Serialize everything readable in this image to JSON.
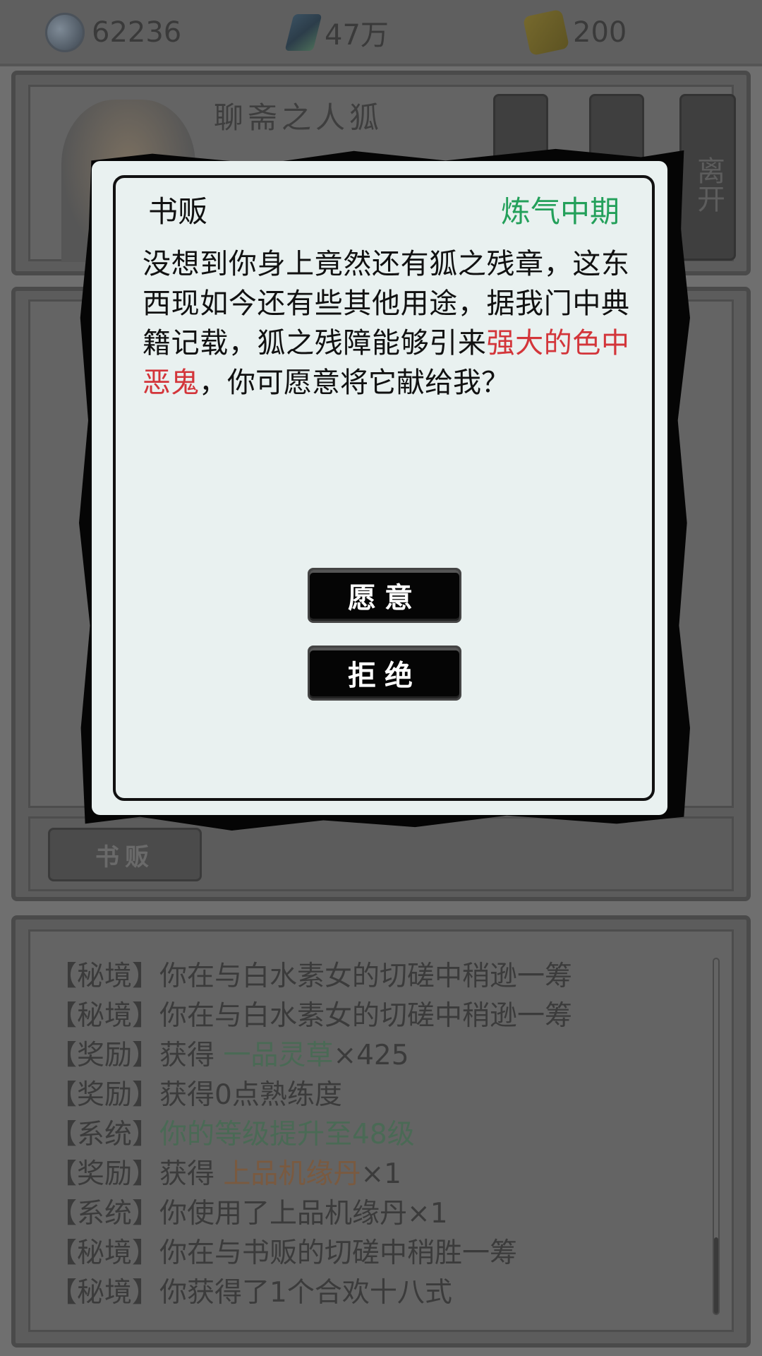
{
  "resources": [
    {
      "icon": "taiji-icon",
      "value": "62236"
    },
    {
      "icon": "spirit-stone-icon",
      "value": "47万"
    },
    {
      "icon": "scroll-icon",
      "value": "200"
    }
  ],
  "top_panel": {
    "line1": "聊斋之人狐",
    "line2": "",
    "side_buttons": [
      "",
      "",
      "离开"
    ]
  },
  "npc_button": "书贩",
  "dialog": {
    "npc_name": "书贩",
    "npc_realm": "炼气中期",
    "text_before": "没想到你身上竟然还有狐之残章，这东西现如今还有些其他用途，据我门中典籍记载，狐之残障能够引来",
    "text_highlight": "强大的色中恶鬼",
    "text_after": "，你可愿意将它献给我？",
    "accept_label": "愿意",
    "reject_label": "拒绝"
  },
  "log": [
    {
      "tag": "【秘境】",
      "text": "你在与白水素女的切磋中稍逊一筹"
    },
    {
      "tag": "【秘境】",
      "text": "你在与白水素女的切磋中稍逊一筹"
    },
    {
      "tag": "【奖励】",
      "prefix": "获得 ",
      "item": "一品灵草",
      "suffix": "×425",
      "color": "green"
    },
    {
      "tag": "【奖励】",
      "text": "获得0点熟练度"
    },
    {
      "tag": "【系统】",
      "text_green": "你的等级提升至48级"
    },
    {
      "tag": "【奖励】",
      "prefix": "获得 ",
      "item": "上品机缘丹",
      "suffix": "×1",
      "color": "orange"
    },
    {
      "tag": "【系统】",
      "text": "你使用了上品机缘丹×1"
    },
    {
      "tag": "【秘境】",
      "text": "你在与书贩的切磋中稍胜一筹"
    },
    {
      "tag": "【秘境】",
      "text": "你获得了1个合欢十八式"
    }
  ]
}
